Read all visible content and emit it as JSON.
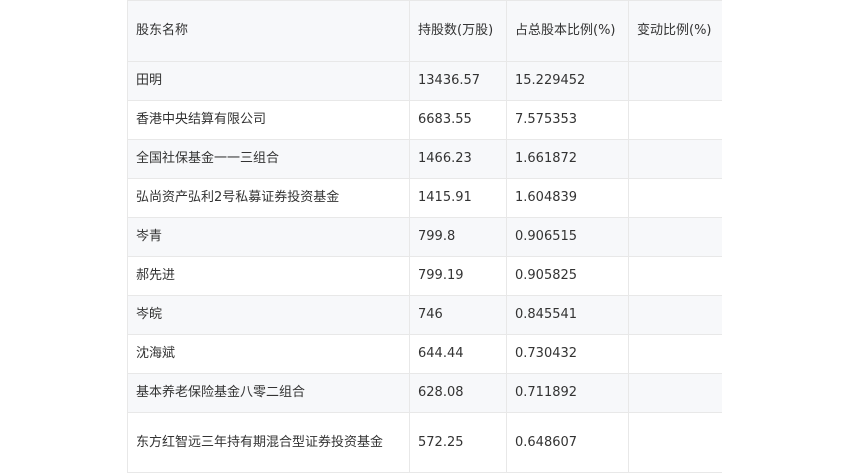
{
  "table": {
    "headers": [
      "股东名称",
      "持股数(万股)",
      "占总股本比例(%)",
      "变动比例(%)"
    ],
    "rows": [
      [
        "田明",
        "13436.57",
        "15.229452",
        ""
      ],
      [
        "香港中央结算有限公司",
        "6683.55",
        "7.575353",
        ""
      ],
      [
        "全国社保基金一一三组合",
        "1466.23",
        "1.661872",
        ""
      ],
      [
        "弘尚资产弘利2号私募证券投资基金",
        "1415.91",
        "1.604839",
        ""
      ],
      [
        "岑青",
        "799.8",
        "0.906515",
        ""
      ],
      [
        "郝先进",
        "799.19",
        "0.905825",
        ""
      ],
      [
        "岑皖",
        "746",
        "0.845541",
        ""
      ],
      [
        "沈海斌",
        "644.44",
        "0.730432",
        ""
      ],
      [
        "基本养老保险基金八零二组合",
        "628.08",
        "0.711892",
        ""
      ],
      [
        "东方红智远三年持有期混合型证券投资基金",
        "572.25",
        "0.648607",
        ""
      ]
    ]
  }
}
